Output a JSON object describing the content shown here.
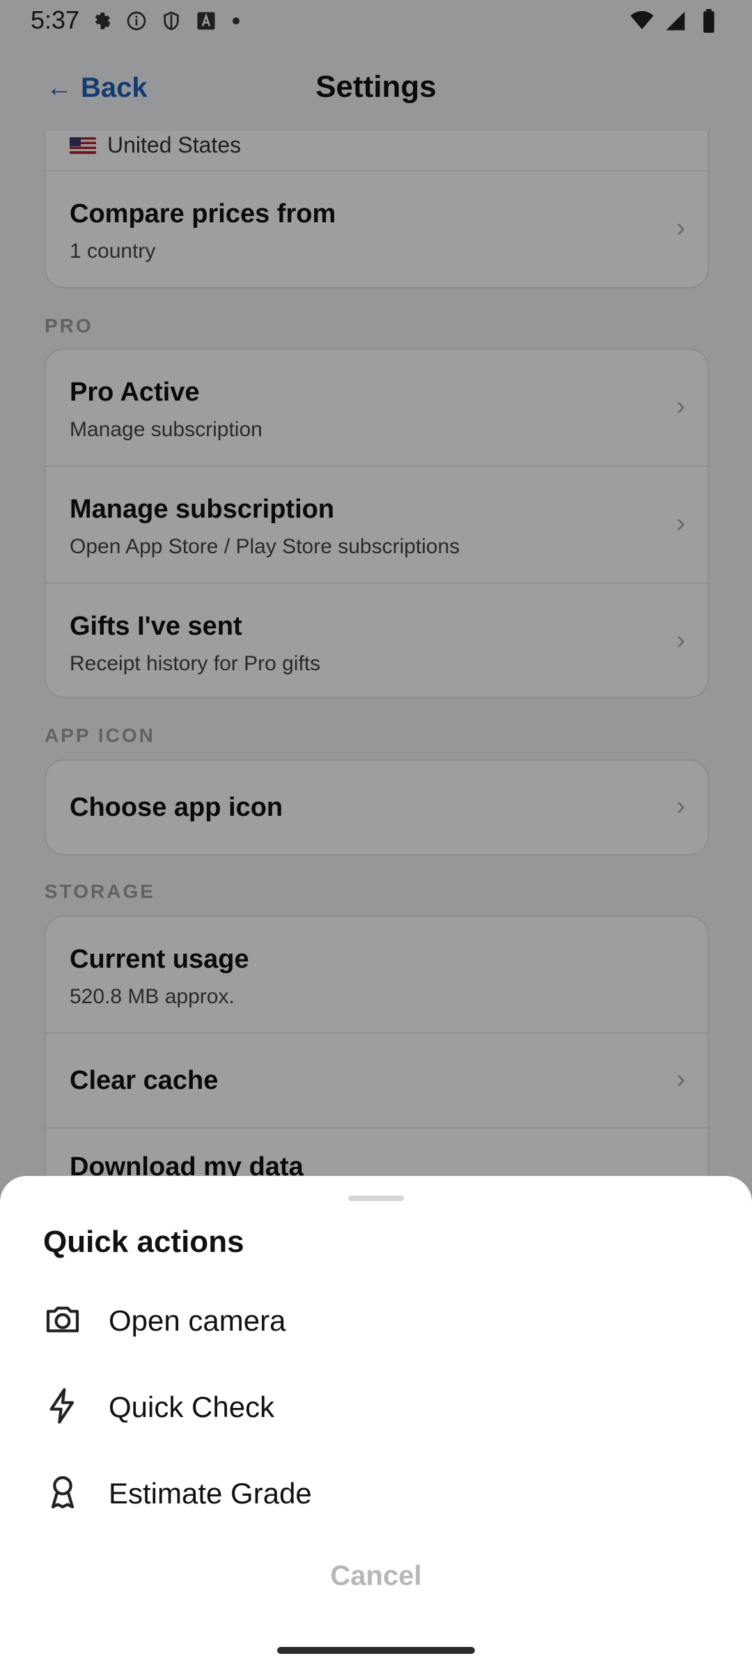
{
  "status_bar": {
    "time": "5:37"
  },
  "header": {
    "back": "Back",
    "title": "Settings"
  },
  "content": {
    "region_row": {
      "label": "United States"
    },
    "compare_prices": {
      "title": "Compare prices from",
      "sub": "1 country"
    },
    "pro_section_label": "PRO",
    "pro_rows": [
      {
        "title": "Pro Active",
        "sub": "Manage subscription"
      },
      {
        "title": "Manage subscription",
        "sub": "Open App Store / Play Store subscriptions"
      },
      {
        "title": "Gifts I've sent",
        "sub": "Receipt history for Pro gifts"
      }
    ],
    "app_icon_section_label": "APP ICON",
    "app_icon_row": {
      "title": "Choose app icon"
    },
    "storage_section_label": "STORAGE",
    "storage_rows": [
      {
        "title": "Current usage",
        "sub": "520.8 MB approx."
      },
      {
        "title": "Clear cache"
      },
      {
        "title": "Download my data"
      }
    ]
  },
  "sheet": {
    "title": "Quick actions",
    "actions": [
      {
        "label": "Open camera",
        "icon": "camera-icon"
      },
      {
        "label": "Quick Check",
        "icon": "bolt-icon"
      },
      {
        "label": "Estimate Grade",
        "icon": "award-icon"
      }
    ],
    "cancel": "Cancel"
  }
}
